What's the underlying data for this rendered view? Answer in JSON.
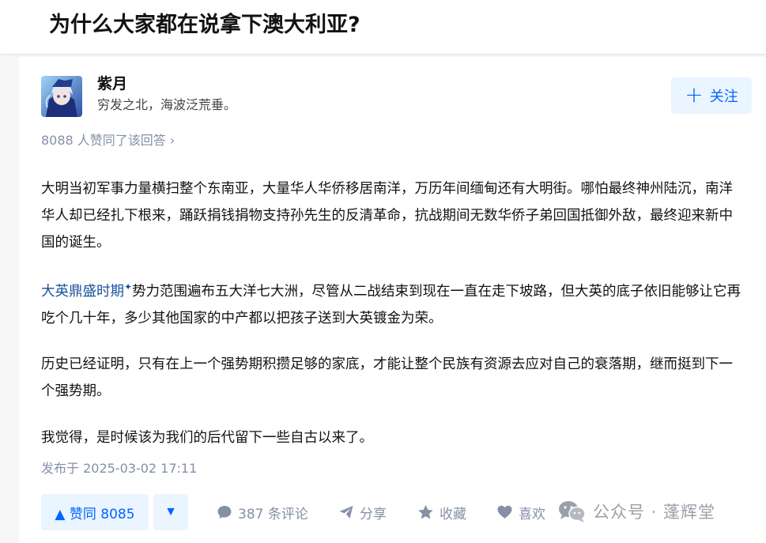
{
  "question": {
    "title": "为什么大家都在说拿下澳大利亚?"
  },
  "author": {
    "name": "紫月",
    "bio": "穷发之北，海波泛荒垂。",
    "follow_label": "关注"
  },
  "answer": {
    "upvote_summary": "8088 人赞同了该回答 ›",
    "paragraphs": {
      "p1": "大明当初军事力量横扫整个东南亚，大量华人华侨移居南洋，万历年间缅甸还有大明街。哪怕最终神州陆沉，南洋华人却已经扎下根来，踊跃捐钱捐物支持孙先生的反清革命，抗战期间无数华侨子弟回国抵御外敌，最终迎来新中国的诞生。",
      "p2_link": "大英鼎盛时期",
      "p2_link_mark": "✦",
      "p2_rest": "势力范围遍布五大洋七大洲，尽管从二战结束到现在一直在走下坡路，但大英的底子依旧能够让它再吃个几十年，多少其他国家的中产都以把孩子送到大英镀金为荣。",
      "p3": "历史已经证明，只有在上一个强势期积攒足够的家底，才能让整个民族有资源去应对自己的衰落期，继而挺到下一个强势期。",
      "p4": "我觉得，是时候该为我们的后代留下一些自古以来了。"
    },
    "publish_time": "发布于 2025-03-02 17:11"
  },
  "actions": {
    "vote_up_label": "▲ 赞同 8085",
    "vote_down_label": "▼",
    "comment_label": "387 条评论",
    "share_label": "分享",
    "favorite_label": "收藏",
    "like_label": "喜欢"
  },
  "watermark": {
    "text": "公众号 · 蓬辉堂"
  },
  "icons": {
    "follow": "plus-icon",
    "comment": "comment-bubble-icon",
    "share": "paper-plane-icon",
    "favorite": "star-icon",
    "like": "heart-icon",
    "watermark": "wechat-icon"
  },
  "colors": {
    "accent": "#0066ff",
    "accent_bg": "#ebf5ff",
    "link": "#175199",
    "muted": "#8590a6",
    "text": "#121212"
  }
}
